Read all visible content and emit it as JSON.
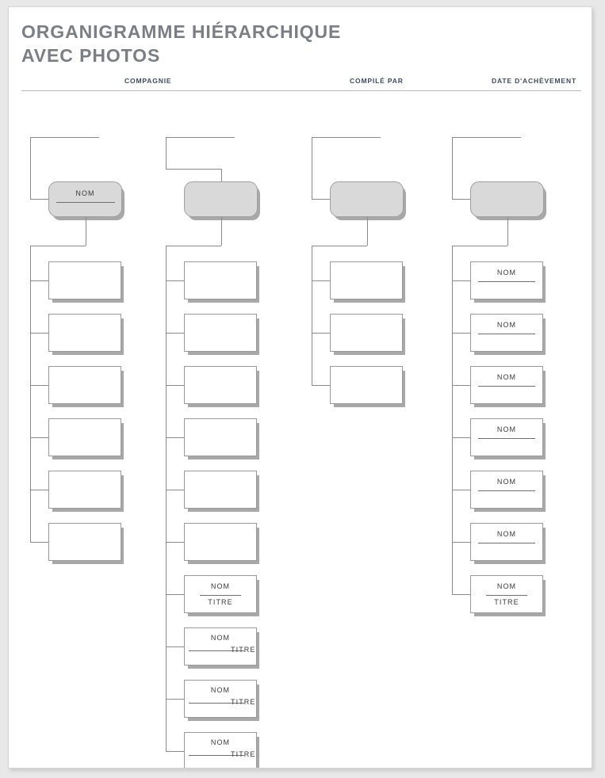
{
  "page": {
    "title_line1": "ORGANIGRAMME HIÉRARCHIQUE",
    "title_line2": "AVEC PHOTOS",
    "title_color": "#7b7f85",
    "accent_color": "#3d4b63",
    "page_background": "#ffffff",
    "canvas_background": "#e8e8e8"
  },
  "meta_fields": [
    {
      "label": "COMPAGNIE"
    },
    {
      "label": "COMPILÉ PAR"
    },
    {
      "label": "DATE D'ACHÈVEMENT"
    }
  ],
  "labels": {
    "nom": "NOM",
    "titre": "TITRE"
  },
  "org_chart": {
    "type": "hierarchy",
    "node_fill_head": "#d9d9d9",
    "node_fill_child": "#ffffff",
    "connector_color": "#8b8b8b",
    "columns": [
      {
        "id": "column-1",
        "head": {
          "nom": "NOM",
          "has_rule": true
        },
        "children": [
          {
            "nom": "",
            "titre": "",
            "style": "blank"
          },
          {
            "nom": "",
            "titre": "",
            "style": "blank"
          },
          {
            "nom": "",
            "titre": "",
            "style": "blank"
          },
          {
            "nom": "",
            "titre": "",
            "style": "blank"
          },
          {
            "nom": "",
            "titre": "",
            "style": "blank"
          },
          {
            "nom": "",
            "titre": "",
            "style": "blank"
          }
        ]
      },
      {
        "id": "column-2",
        "head": {
          "nom": "",
          "has_rule": false
        },
        "children": [
          {
            "nom": "",
            "titre": "",
            "style": "blank"
          },
          {
            "nom": "",
            "titre": "",
            "style": "blank"
          },
          {
            "nom": "",
            "titre": "",
            "style": "blank"
          },
          {
            "nom": "",
            "titre": "",
            "style": "blank"
          },
          {
            "nom": "",
            "titre": "",
            "style": "blank"
          },
          {
            "nom": "",
            "titre": "",
            "style": "blank"
          },
          {
            "nom": "NOM",
            "titre": "TITRE",
            "style": "stacked"
          },
          {
            "nom": "NOM",
            "titre": "TITRE",
            "style": "overlap"
          },
          {
            "nom": "NOM",
            "titre": "TITRE",
            "style": "overlap"
          },
          {
            "nom": "NOM",
            "titre": "TITRE",
            "style": "overlap"
          }
        ]
      },
      {
        "id": "column-3",
        "head": {
          "nom": "",
          "has_rule": false
        },
        "children": [
          {
            "nom": "",
            "titre": "",
            "style": "blank"
          },
          {
            "nom": "",
            "titre": "",
            "style": "blank"
          },
          {
            "nom": "",
            "titre": "",
            "style": "blank"
          }
        ]
      },
      {
        "id": "column-4",
        "head": {
          "nom": "",
          "has_rule": false
        },
        "children": [
          {
            "nom": "NOM",
            "titre": "",
            "style": "nom_only"
          },
          {
            "nom": "NOM",
            "titre": "",
            "style": "nom_only"
          },
          {
            "nom": "NOM",
            "titre": "",
            "style": "nom_only"
          },
          {
            "nom": "NOM",
            "titre": "",
            "style": "nom_only"
          },
          {
            "nom": "NOM",
            "titre": "",
            "style": "nom_only"
          },
          {
            "nom": "NOM",
            "titre": "",
            "style": "nom_only"
          },
          {
            "nom": "NOM",
            "titre": "TITRE",
            "style": "stacked"
          }
        ]
      }
    ]
  }
}
